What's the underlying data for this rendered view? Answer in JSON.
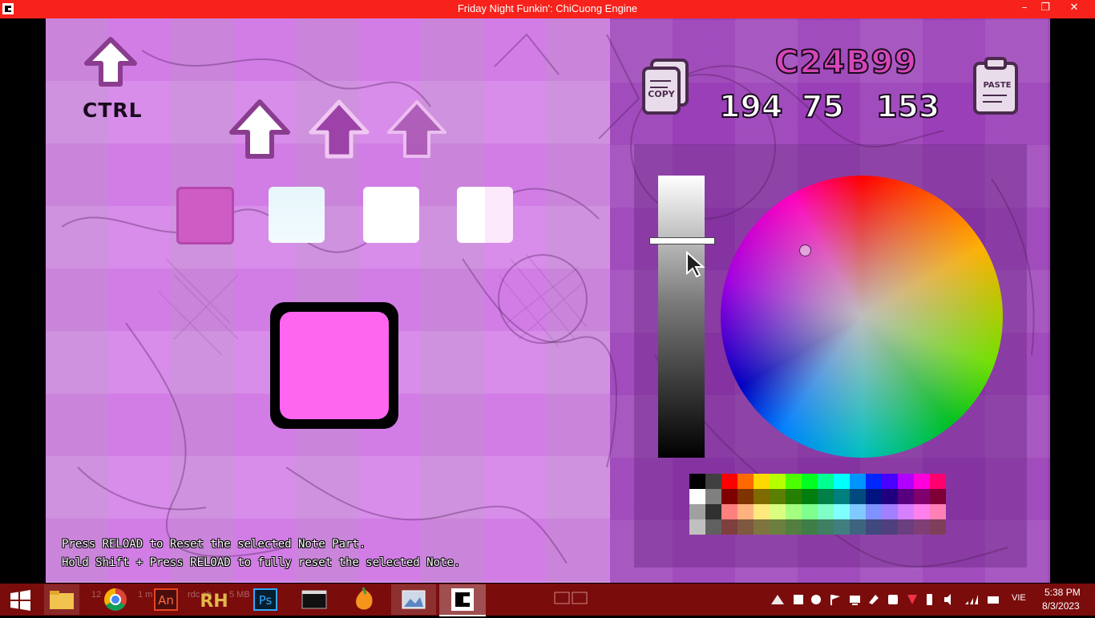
{
  "window": {
    "title": "Friday Night Funkin': ChiCuong Engine",
    "controls": [
      "–",
      "❐",
      "✕"
    ]
  },
  "editor": {
    "keybind_label": "CTRL",
    "help_lines": [
      "Press RELOAD to Reset the selected Note Part.",
      "Hold Shift + Press RELOAD to fully reset the selected Note."
    ],
    "hex": "C24B99",
    "rgb": {
      "r": "194",
      "g": "75",
      "b": "153"
    },
    "copy_label": "COPY",
    "paste_label": "PASTE",
    "note_color": "#ff66f0",
    "selected_color": "#c24b99",
    "brightness_level": 0.77,
    "palette": [
      [
        "#000000",
        "#404040",
        "#ff0000",
        "#ff6a00",
        "#ffd800",
        "#b6ff00",
        "#4cff00",
        "#00ff21",
        "#00ff90",
        "#00ffff",
        "#0094ff",
        "#0026ff",
        "#4800ff",
        "#b200ff",
        "#ff00dc",
        "#ff006e"
      ],
      [
        "#ffffff",
        "#808080",
        "#7f0000",
        "#7f3300",
        "#7f6a00",
        "#5b7f00",
        "#267f00",
        "#007f0e",
        "#007f46",
        "#007f7f",
        "#004a7f",
        "#00137f",
        "#21007f",
        "#57007f",
        "#7f006e",
        "#7f0037"
      ],
      [
        "#a0a0a0",
        "#303030",
        "#ff7f7f",
        "#ffb27f",
        "#ffe97f",
        "#daff7f",
        "#a5ff7f",
        "#7fff8e",
        "#7fffc5",
        "#7fffff",
        "#7fc9ff",
        "#7f92ff",
        "#a17fff",
        "#d67fff",
        "#ff7fed",
        "#ff7fb6"
      ],
      [
        "#c0c0c0",
        "#606060",
        "#7f3f3f",
        "#7f593f",
        "#7f743f",
        "#6d7f3f",
        "#527f3f",
        "#3f7f47",
        "#3f7f62",
        "#3f7f7f",
        "#3f647f",
        "#3f497f",
        "#503f7f",
        "#6b3f7f",
        "#7f3f76",
        "#7f3f5b"
      ]
    ]
  },
  "taskbar": {
    "faint_1": "12",
    "faint_2": "1 m",
    "faint_3": "rdc ch",
    "faint_4": "5 MB",
    "language": "VIE",
    "time": "5:38 PM",
    "date": "8/3/2023"
  }
}
